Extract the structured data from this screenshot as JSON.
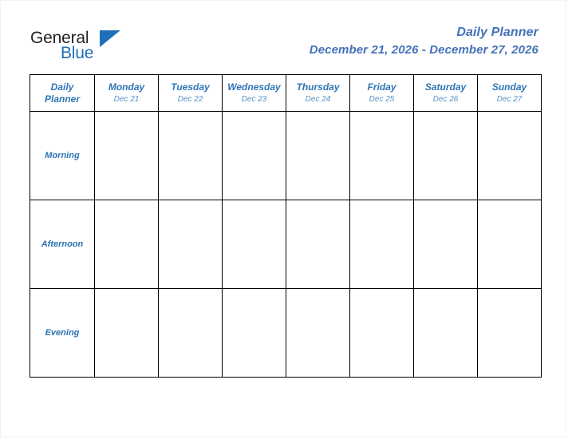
{
  "brand": {
    "name_part1": "General",
    "name_part2": "Blue",
    "triangle_icon": "brand-triangle-icon",
    "color_dark": "#231f20",
    "color_blue": "#1f6fb8"
  },
  "header": {
    "title": "Daily Planner",
    "date_range": "December 21, 2026 - December 27, 2026",
    "title_color": "#4472b8"
  },
  "planner": {
    "corner_label_line1": "Daily",
    "corner_label_line2": "Planner",
    "header_bg": "#dde8cf",
    "label_bg": "#e9e9e9",
    "text_color": "#2e74b5",
    "days": [
      {
        "name": "Monday",
        "date": "Dec 21"
      },
      {
        "name": "Tuesday",
        "date": "Dec 22"
      },
      {
        "name": "Wednesday",
        "date": "Dec 23"
      },
      {
        "name": "Thursday",
        "date": "Dec 24"
      },
      {
        "name": "Friday",
        "date": "Dec 25"
      },
      {
        "name": "Saturday",
        "date": "Dec 26"
      },
      {
        "name": "Sunday",
        "date": "Dec 27"
      }
    ],
    "slots": [
      {
        "label": "Morning",
        "entries": [
          "",
          "",
          "",
          "",
          "",
          "",
          ""
        ]
      },
      {
        "label": "Afternoon",
        "entries": [
          "",
          "",
          "",
          "",
          "",
          "",
          ""
        ]
      },
      {
        "label": "Evening",
        "entries": [
          "",
          "",
          "",
          "",
          "",
          "",
          ""
        ]
      }
    ]
  }
}
